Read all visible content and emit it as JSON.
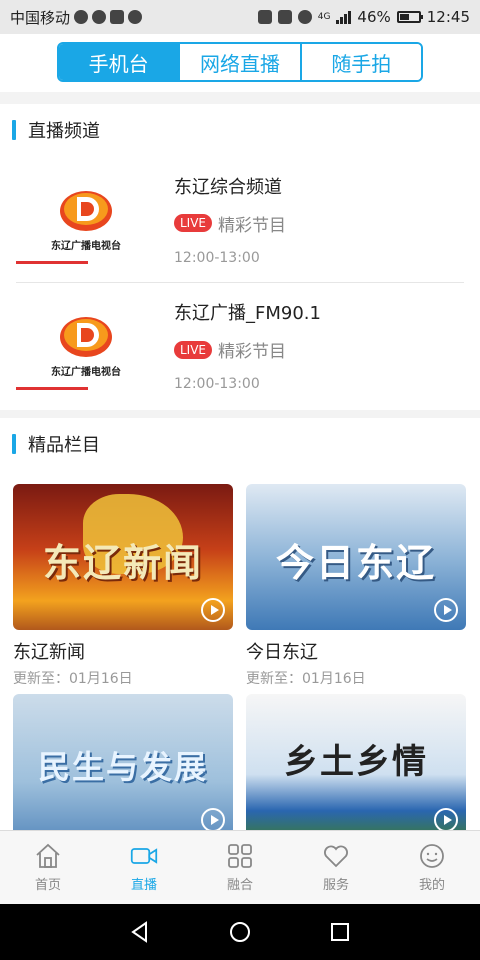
{
  "status_bar": {
    "carrier": "中国移动",
    "battery": "46%",
    "time": "12:45",
    "network": "4G"
  },
  "top_tabs": [
    {
      "label": "手机台",
      "active": true
    },
    {
      "label": "网络直播",
      "active": false
    },
    {
      "label": "随手拍",
      "active": false
    }
  ],
  "live_section": {
    "title": "直播频道",
    "channels": [
      {
        "name": "东辽综合频道",
        "badge": "LIVE",
        "program": "精彩节目",
        "time": "12:00-13:00",
        "logo_text": "东辽广播电视台"
      },
      {
        "name": "东辽广播_FM90.1",
        "badge": "LIVE",
        "program": "精彩节目",
        "time": "12:00-13:00",
        "logo_text": "东辽广播电视台"
      }
    ]
  },
  "premium_section": {
    "title": "精品栏目",
    "items": [
      {
        "title": "东辽新闻",
        "updated": "更新至：01月16日",
        "thumb_text": "东辽新闻"
      },
      {
        "title": "今日东辽",
        "updated": "更新至：01月16日",
        "thumb_text": "今日东辽"
      },
      {
        "title": "",
        "updated": "",
        "thumb_text": "民生与发展"
      },
      {
        "title": "",
        "updated": "",
        "thumb_text": "乡土乡情"
      }
    ]
  },
  "bottom_nav": [
    {
      "label": "首页",
      "icon": "home-icon",
      "active": false
    },
    {
      "label": "直播",
      "icon": "video-camera-icon",
      "active": true
    },
    {
      "label": "融合",
      "icon": "grid-icon",
      "active": false
    },
    {
      "label": "服务",
      "icon": "heart-icon",
      "active": false
    },
    {
      "label": "我的",
      "icon": "smiley-icon",
      "active": false
    }
  ],
  "colors": {
    "accent": "#1aa7e6",
    "live_red": "#e83b3b"
  }
}
